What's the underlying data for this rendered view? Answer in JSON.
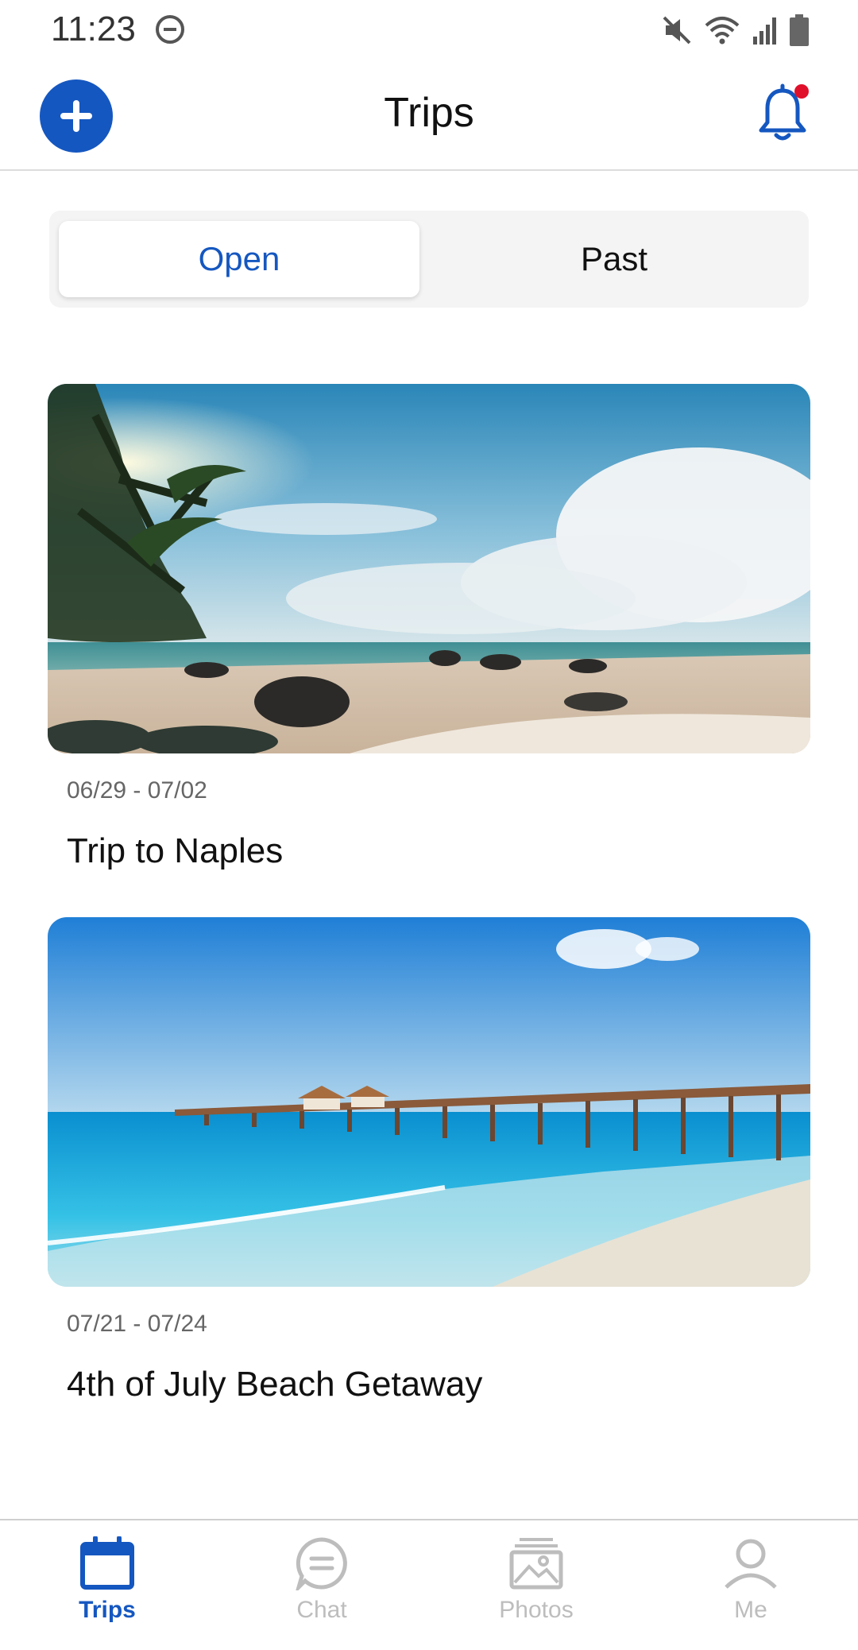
{
  "status_bar": {
    "time": "11:23",
    "icons": [
      "do-not-disturb-icon",
      "mute-icon",
      "wifi-icon",
      "signal-icon",
      "battery-icon"
    ]
  },
  "header": {
    "title": "Trips",
    "add_icon": "plus-icon",
    "bell_icon": "bell-icon",
    "has_notification": true
  },
  "tabs": {
    "open_label": "Open",
    "past_label": "Past",
    "selected": "Open"
  },
  "trips": [
    {
      "dates": "06/29 - 07/02",
      "title": "Trip to Naples"
    },
    {
      "dates": "07/21 - 07/24",
      "title": "4th of July Beach Getaway"
    }
  ],
  "bottom_nav": {
    "items": [
      {
        "label": "Trips",
        "icon": "calendar-icon",
        "active": true
      },
      {
        "label": "Chat",
        "icon": "chat-icon",
        "active": false
      },
      {
        "label": "Photos",
        "icon": "photos-icon",
        "active": false
      },
      {
        "label": "Me",
        "icon": "person-icon",
        "active": false
      }
    ]
  },
  "colors": {
    "accent": "#1557c0",
    "notification": "#e0102a",
    "inactive": "#bdbdbd"
  }
}
